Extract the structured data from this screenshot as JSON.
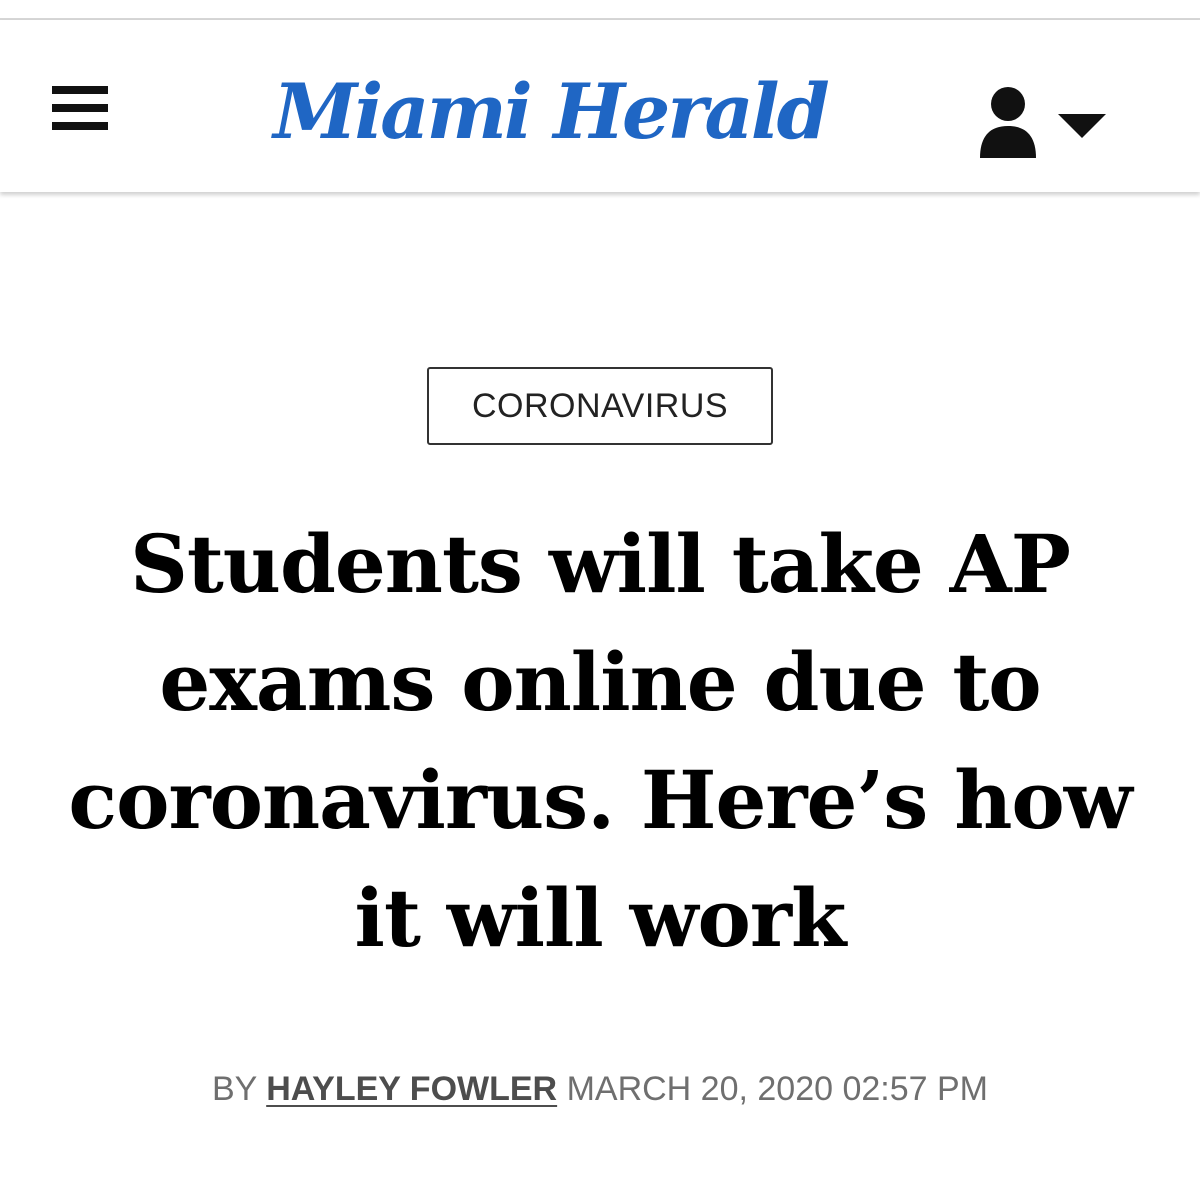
{
  "header": {
    "logo_text": "Miami Herald",
    "logo_color": "#1f66c4",
    "menu_icon": "hamburger-menu-icon",
    "account_icon": "user-icon",
    "dropdown_icon": "caret-down-icon"
  },
  "article": {
    "section_tag": "CORONAVIRUS",
    "headline": "Students will take AP exams online due to coronavirus. Here’s how it will work",
    "byline": {
      "prefix": "BY",
      "author": "HAYLEY FOWLER",
      "timestamp": "MARCH 20, 2020 02:57 PM"
    }
  }
}
